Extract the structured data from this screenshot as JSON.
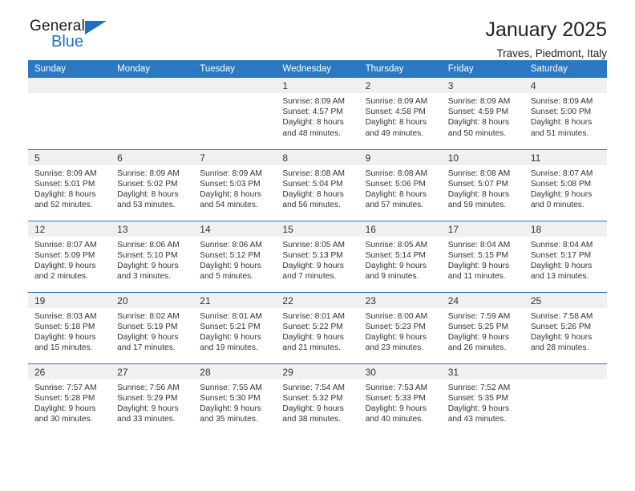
{
  "brand": {
    "name_top": "General",
    "name_bottom": "Blue",
    "accent_color": "#1f70c1"
  },
  "header": {
    "title": "January 2025",
    "subtitle": "Traves, Piedmont, Italy"
  },
  "calendar": {
    "header_bg": "#2b78c2",
    "daynum_bg": "#f0f0f0",
    "weekdays": [
      "Sunday",
      "Monday",
      "Tuesday",
      "Wednesday",
      "Thursday",
      "Friday",
      "Saturday"
    ],
    "weeks": [
      [
        {
          "day": "",
          "sunrise": "",
          "sunset": "",
          "daylight_1": "",
          "daylight_2": ""
        },
        {
          "day": "",
          "sunrise": "",
          "sunset": "",
          "daylight_1": "",
          "daylight_2": ""
        },
        {
          "day": "",
          "sunrise": "",
          "sunset": "",
          "daylight_1": "",
          "daylight_2": ""
        },
        {
          "day": "1",
          "sunrise": "Sunrise: 8:09 AM",
          "sunset": "Sunset: 4:57 PM",
          "daylight_1": "Daylight: 8 hours",
          "daylight_2": "and 48 minutes."
        },
        {
          "day": "2",
          "sunrise": "Sunrise: 8:09 AM",
          "sunset": "Sunset: 4:58 PM",
          "daylight_1": "Daylight: 8 hours",
          "daylight_2": "and 49 minutes."
        },
        {
          "day": "3",
          "sunrise": "Sunrise: 8:09 AM",
          "sunset": "Sunset: 4:59 PM",
          "daylight_1": "Daylight: 8 hours",
          "daylight_2": "and 50 minutes."
        },
        {
          "day": "4",
          "sunrise": "Sunrise: 8:09 AM",
          "sunset": "Sunset: 5:00 PM",
          "daylight_1": "Daylight: 8 hours",
          "daylight_2": "and 51 minutes."
        }
      ],
      [
        {
          "day": "5",
          "sunrise": "Sunrise: 8:09 AM",
          "sunset": "Sunset: 5:01 PM",
          "daylight_1": "Daylight: 8 hours",
          "daylight_2": "and 52 minutes."
        },
        {
          "day": "6",
          "sunrise": "Sunrise: 8:09 AM",
          "sunset": "Sunset: 5:02 PM",
          "daylight_1": "Daylight: 8 hours",
          "daylight_2": "and 53 minutes."
        },
        {
          "day": "7",
          "sunrise": "Sunrise: 8:09 AM",
          "sunset": "Sunset: 5:03 PM",
          "daylight_1": "Daylight: 8 hours",
          "daylight_2": "and 54 minutes."
        },
        {
          "day": "8",
          "sunrise": "Sunrise: 8:08 AM",
          "sunset": "Sunset: 5:04 PM",
          "daylight_1": "Daylight: 8 hours",
          "daylight_2": "and 56 minutes."
        },
        {
          "day": "9",
          "sunrise": "Sunrise: 8:08 AM",
          "sunset": "Sunset: 5:06 PM",
          "daylight_1": "Daylight: 8 hours",
          "daylight_2": "and 57 minutes."
        },
        {
          "day": "10",
          "sunrise": "Sunrise: 8:08 AM",
          "sunset": "Sunset: 5:07 PM",
          "daylight_1": "Daylight: 8 hours",
          "daylight_2": "and 59 minutes."
        },
        {
          "day": "11",
          "sunrise": "Sunrise: 8:07 AM",
          "sunset": "Sunset: 5:08 PM",
          "daylight_1": "Daylight: 9 hours",
          "daylight_2": "and 0 minutes."
        }
      ],
      [
        {
          "day": "12",
          "sunrise": "Sunrise: 8:07 AM",
          "sunset": "Sunset: 5:09 PM",
          "daylight_1": "Daylight: 9 hours",
          "daylight_2": "and 2 minutes."
        },
        {
          "day": "13",
          "sunrise": "Sunrise: 8:06 AM",
          "sunset": "Sunset: 5:10 PM",
          "daylight_1": "Daylight: 9 hours",
          "daylight_2": "and 3 minutes."
        },
        {
          "day": "14",
          "sunrise": "Sunrise: 8:06 AM",
          "sunset": "Sunset: 5:12 PM",
          "daylight_1": "Daylight: 9 hours",
          "daylight_2": "and 5 minutes."
        },
        {
          "day": "15",
          "sunrise": "Sunrise: 8:05 AM",
          "sunset": "Sunset: 5:13 PM",
          "daylight_1": "Daylight: 9 hours",
          "daylight_2": "and 7 minutes."
        },
        {
          "day": "16",
          "sunrise": "Sunrise: 8:05 AM",
          "sunset": "Sunset: 5:14 PM",
          "daylight_1": "Daylight: 9 hours",
          "daylight_2": "and 9 minutes."
        },
        {
          "day": "17",
          "sunrise": "Sunrise: 8:04 AM",
          "sunset": "Sunset: 5:15 PM",
          "daylight_1": "Daylight: 9 hours",
          "daylight_2": "and 11 minutes."
        },
        {
          "day": "18",
          "sunrise": "Sunrise: 8:04 AM",
          "sunset": "Sunset: 5:17 PM",
          "daylight_1": "Daylight: 9 hours",
          "daylight_2": "and 13 minutes."
        }
      ],
      [
        {
          "day": "19",
          "sunrise": "Sunrise: 8:03 AM",
          "sunset": "Sunset: 5:18 PM",
          "daylight_1": "Daylight: 9 hours",
          "daylight_2": "and 15 minutes."
        },
        {
          "day": "20",
          "sunrise": "Sunrise: 8:02 AM",
          "sunset": "Sunset: 5:19 PM",
          "daylight_1": "Daylight: 9 hours",
          "daylight_2": "and 17 minutes."
        },
        {
          "day": "21",
          "sunrise": "Sunrise: 8:01 AM",
          "sunset": "Sunset: 5:21 PM",
          "daylight_1": "Daylight: 9 hours",
          "daylight_2": "and 19 minutes."
        },
        {
          "day": "22",
          "sunrise": "Sunrise: 8:01 AM",
          "sunset": "Sunset: 5:22 PM",
          "daylight_1": "Daylight: 9 hours",
          "daylight_2": "and 21 minutes."
        },
        {
          "day": "23",
          "sunrise": "Sunrise: 8:00 AM",
          "sunset": "Sunset: 5:23 PM",
          "daylight_1": "Daylight: 9 hours",
          "daylight_2": "and 23 minutes."
        },
        {
          "day": "24",
          "sunrise": "Sunrise: 7:59 AM",
          "sunset": "Sunset: 5:25 PM",
          "daylight_1": "Daylight: 9 hours",
          "daylight_2": "and 26 minutes."
        },
        {
          "day": "25",
          "sunrise": "Sunrise: 7:58 AM",
          "sunset": "Sunset: 5:26 PM",
          "daylight_1": "Daylight: 9 hours",
          "daylight_2": "and 28 minutes."
        }
      ],
      [
        {
          "day": "26",
          "sunrise": "Sunrise: 7:57 AM",
          "sunset": "Sunset: 5:28 PM",
          "daylight_1": "Daylight: 9 hours",
          "daylight_2": "and 30 minutes."
        },
        {
          "day": "27",
          "sunrise": "Sunrise: 7:56 AM",
          "sunset": "Sunset: 5:29 PM",
          "daylight_1": "Daylight: 9 hours",
          "daylight_2": "and 33 minutes."
        },
        {
          "day": "28",
          "sunrise": "Sunrise: 7:55 AM",
          "sunset": "Sunset: 5:30 PM",
          "daylight_1": "Daylight: 9 hours",
          "daylight_2": "and 35 minutes."
        },
        {
          "day": "29",
          "sunrise": "Sunrise: 7:54 AM",
          "sunset": "Sunset: 5:32 PM",
          "daylight_1": "Daylight: 9 hours",
          "daylight_2": "and 38 minutes."
        },
        {
          "day": "30",
          "sunrise": "Sunrise: 7:53 AM",
          "sunset": "Sunset: 5:33 PM",
          "daylight_1": "Daylight: 9 hours",
          "daylight_2": "and 40 minutes."
        },
        {
          "day": "31",
          "sunrise": "Sunrise: 7:52 AM",
          "sunset": "Sunset: 5:35 PM",
          "daylight_1": "Daylight: 9 hours",
          "daylight_2": "and 43 minutes."
        },
        {
          "day": "",
          "sunrise": "",
          "sunset": "",
          "daylight_1": "",
          "daylight_2": ""
        }
      ]
    ]
  }
}
